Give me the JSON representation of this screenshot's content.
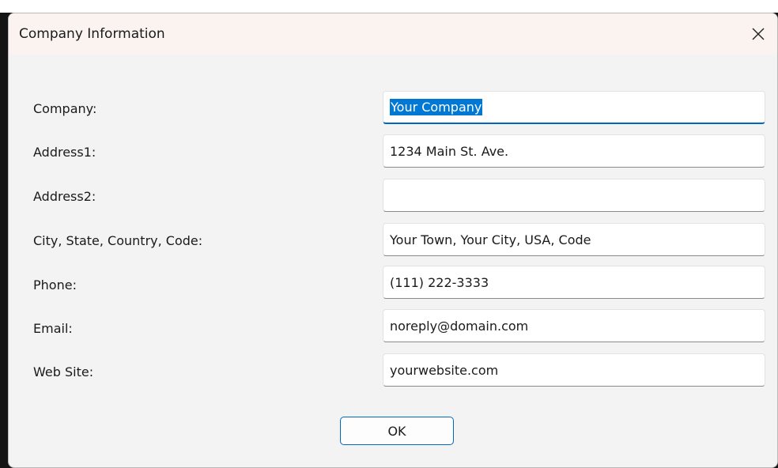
{
  "dialog": {
    "title": "Company Information",
    "close_icon": "close-icon",
    "fields": [
      {
        "label": "Company:",
        "value": "Your Company",
        "focused": true
      },
      {
        "label": "Address1:",
        "value": "1234 Main St. Ave."
      },
      {
        "label": "Address2:",
        "value": ""
      },
      {
        "label": "City, State, Country, Code:",
        "value": "Your Town, Your City, USA, Code"
      },
      {
        "label": "Phone:",
        "value": "(111) 222-3333"
      },
      {
        "label": "Email:",
        "value": "noreply@domain.com"
      },
      {
        "label": "Web Site:",
        "value": "yourwebsite.com"
      }
    ],
    "ok_label": "OK"
  },
  "colors": {
    "accent": "#0067c0",
    "selection": "#0078d4",
    "dialog_bg": "#f3f3f3",
    "titlebar_bg": "#fbf3f0"
  }
}
